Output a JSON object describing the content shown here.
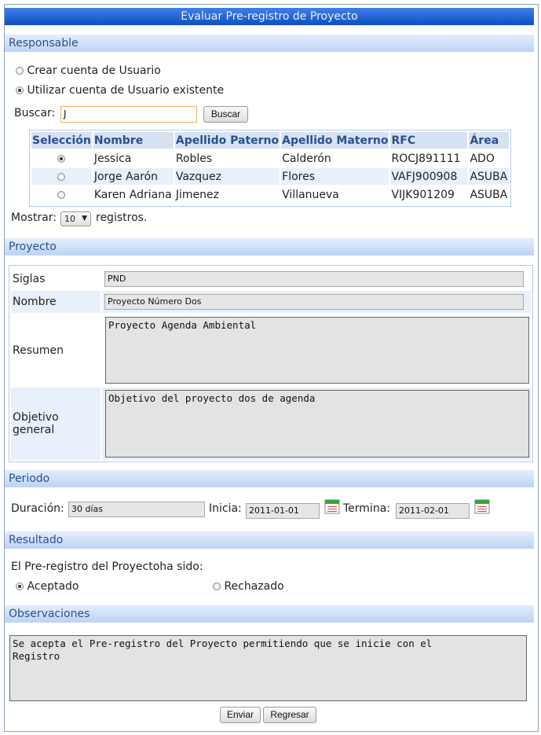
{
  "title": "Evaluar Pre-registro de Proyecto",
  "responsable": {
    "section_label": "Responsable",
    "option_create": "Crear cuenta de Usuario",
    "option_existing": "Utilizar cuenta de Usuario existente",
    "selected_option": "existing",
    "search_label": "Buscar:",
    "search_value": "J",
    "search_button": "Buscar",
    "columns": [
      "Selección",
      "Nombre",
      "Apellido Paterno",
      "Apellido Materno",
      "RFC",
      "Área"
    ],
    "rows": [
      {
        "selected": true,
        "nombre": "Jessica",
        "paterno": "Robles",
        "materno": "Calderón",
        "rfc": "ROCJ891111",
        "area": "ADO"
      },
      {
        "selected": false,
        "nombre": "Jorge Aarón",
        "paterno": "Vazquez",
        "materno": "Flores",
        "rfc": "VAFJ900908",
        "area": "ASUBA"
      },
      {
        "selected": false,
        "nombre": "Karen Adriana",
        "paterno": "Jimenez",
        "materno": "Villanueva",
        "rfc": "VIJK901209",
        "area": "ASUBA"
      }
    ],
    "show_label": "Mostrar:",
    "show_value": "10",
    "show_suffix": "registros."
  },
  "proyecto": {
    "section_label": "Proyecto",
    "siglas_label": "Siglas",
    "siglas_value": "PND",
    "nombre_label": "Nombre",
    "nombre_value": "Proyecto Número Dos",
    "resumen_label": "Resumen",
    "resumen_value": "Proyecto Agenda Ambiental",
    "objetivo_label": "Objetivo general",
    "objetivo_value": "Objetivo del proyecto dos de agenda"
  },
  "periodo": {
    "section_label": "Periodo",
    "duracion_label": "Duración:",
    "duracion_value": "30 días",
    "inicia_label": "Inicia:",
    "inicia_value": "2011-01-01",
    "termina_label": "Termina:",
    "termina_value": "2011-02-01"
  },
  "resultado": {
    "section_label": "Resultado",
    "question": "El Pre-registro del Proyectoha sido:",
    "option_accept": "Aceptado",
    "option_reject": "Rechazado",
    "selected": "accept"
  },
  "observaciones": {
    "section_label": "Observaciones",
    "value": "Se acepta el Pre-registro del Proyecto permitiendo que se inicie con el\nRegistro"
  },
  "actions": {
    "submit": "Enviar",
    "back": "Regresar"
  },
  "colors": {
    "title_bar": "#0e4fc0",
    "section_header": "#bcd3f4",
    "section_text": "#2a4f8f",
    "row_alt": "#e7f0fb"
  }
}
